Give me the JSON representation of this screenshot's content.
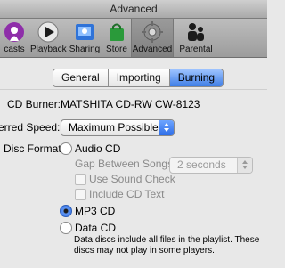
{
  "window": {
    "title": "Advanced"
  },
  "toolbar": {
    "items": [
      {
        "label": "Podcasts",
        "visible_label": "casts",
        "icon": "podcast-icon"
      },
      {
        "label": "Playback",
        "icon": "play-icon"
      },
      {
        "label": "Sharing",
        "icon": "sharing-icon"
      },
      {
        "label": "Store",
        "icon": "store-bag-icon"
      },
      {
        "label": "Advanced",
        "icon": "gear-icon",
        "selected": true
      },
      {
        "label": "Parental",
        "icon": "parental-icon"
      }
    ]
  },
  "tabs": [
    {
      "label": "General",
      "active": false
    },
    {
      "label": "Importing",
      "active": false
    },
    {
      "label": "Burning",
      "active": true
    }
  ],
  "burning": {
    "cd_burner_label": "CD Burner:",
    "cd_burner_value": "MATSHITA CD-RW  CW-8123",
    "preferred_speed_label": "erred Speed:",
    "preferred_speed_value": "Maximum Possible",
    "disc_format_label": "Disc Format:",
    "options": {
      "audio_cd": "Audio CD",
      "gap_between_songs_label": "Gap Between Songs:",
      "gap_between_songs_value": "2 seconds",
      "use_sound_check": "Use Sound Check",
      "include_cd_text": "Include CD Text",
      "mp3_cd": "MP3 CD",
      "data_cd": "Data CD"
    },
    "selected_format": "MP3 CD",
    "data_cd_note": "Data discs include all files in the playlist. These discs may not play in some players."
  },
  "colors": {
    "accent": "#2f6ee8",
    "tab_active": "#3f7ee6",
    "disabled_text": "#8a8a8a"
  }
}
